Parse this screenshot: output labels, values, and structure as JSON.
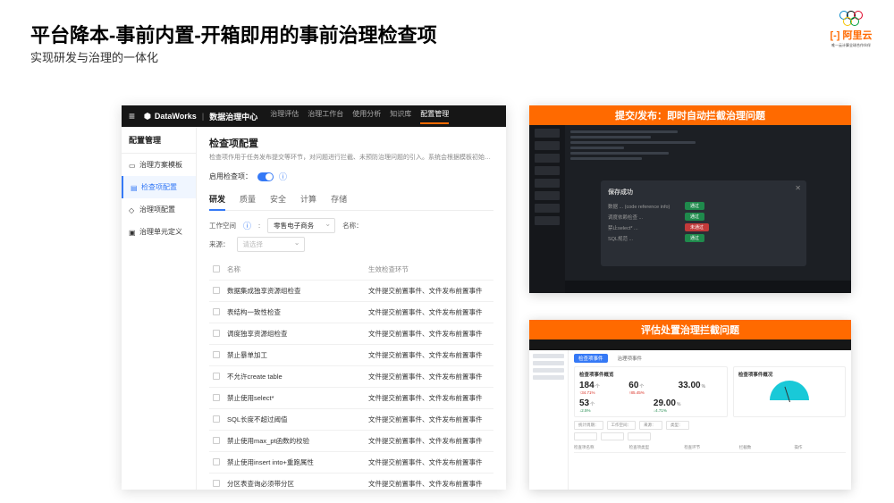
{
  "slide": {
    "title": "平台降本-事前内置-开箱即用的事前治理检查项",
    "subtitle": "实现研发与治理的一体化"
  },
  "logo": {
    "brand": "[-] 阿里云",
    "sub": "唯一云计算全球合作伙伴"
  },
  "main_shot": {
    "brand_product": "DataWorks",
    "brand_module": "数据治理中心",
    "nav_tabs": [
      "治理评估",
      "治理工作台",
      "使用分析",
      "知识库",
      "配置管理"
    ],
    "nav_active": 4,
    "sidebar_title": "配置管理",
    "sidebar_items": [
      {
        "icon": "▭",
        "label": "治理方案模板"
      },
      {
        "icon": "▤",
        "label": "检查项配置"
      },
      {
        "icon": "◇",
        "label": "治理项配置"
      },
      {
        "icon": "▣",
        "label": "治理单元定义"
      }
    ],
    "sidebar_selected": 1,
    "page_title": "检查项配置",
    "page_desc": "检查项作用于任务发布提交等环节，对问题进行拦截、未预防治理问题的引入。系统会根据模板初始…",
    "enable_label": "启用检查项：",
    "content_tabs": [
      "研发",
      "质量",
      "安全",
      "计算",
      "存储"
    ],
    "content_tab_active": 0,
    "filter_workspace_label": "工作空间",
    "filter_workspace_value": "零售电子商务",
    "filter_name_label": "名称：",
    "filter_source_label": "来源：",
    "filter_source_placeholder": "请选择",
    "table_headers": {
      "name": "名称",
      "stage": "生效检查环节"
    },
    "rows": [
      {
        "name": "数据集成独享资源组检查",
        "stage": "文件提交前置事件、文件发布前置事件"
      },
      {
        "name": "表结构一致性检查",
        "stage": "文件提交前置事件、文件发布前置事件"
      },
      {
        "name": "调度独享资源组检查",
        "stage": "文件提交前置事件、文件发布前置事件"
      },
      {
        "name": "禁止暴单加工",
        "stage": "文件提交前置事件、文件发布前置事件"
      },
      {
        "name": "不允许create table",
        "stage": "文件提交前置事件、文件发布前置事件"
      },
      {
        "name": "禁止使用select*",
        "stage": "文件提交前置事件、文件发布前置事件"
      },
      {
        "name": "SQL长度不超过阈值",
        "stage": "文件提交前置事件、文件发布前置事件"
      },
      {
        "name": "禁止使用max_pt函数的校验",
        "stage": "文件提交前置事件、文件发布前置事件"
      },
      {
        "name": "禁止使用insert into+重跑属性",
        "stage": "文件提交前置事件、文件发布前置事件"
      },
      {
        "name": "分区表查询必须带分区",
        "stage": "文件提交前置事件、文件发布前置事件"
      }
    ]
  },
  "right1": {
    "banner": "提交/发布：即时自动拦截治理问题",
    "modal_title": "保存成功",
    "rows": [
      {
        "lab": "数据 ... (code reference info)",
        "pill": "通过",
        "cls": "green"
      },
      {
        "lab": "调度依赖检查 ...",
        "pill": "通过",
        "cls": "green"
      },
      {
        "lab": "禁止select* ...",
        "pill": "未通过",
        "cls": "red"
      },
      {
        "lab": "SQL规范 ...",
        "pill": "通过",
        "cls": "green"
      }
    ]
  },
  "right2": {
    "banner": "评估处置治理拦截问题",
    "tabs": [
      "检查项事件",
      "治理项事件"
    ],
    "card1_title": "检查项事件概览",
    "card2_title": "检查项事件概况",
    "stats_row1": [
      {
        "num": "184",
        "unit": "个",
        "delta": "↑34.71%",
        "dir": "up"
      },
      {
        "num": "60",
        "unit": "个",
        "delta": "↑85.45%",
        "dir": "up"
      },
      {
        "num": "33.00",
        "unit": "%",
        "delta": "",
        "dir": ""
      }
    ],
    "stats_row2": [
      {
        "num": "53",
        "unit": "个",
        "delta": "↓2.5%",
        "dir": "down"
      },
      {
        "num": "29.00",
        "unit": "%",
        "delta": "↓4.71%",
        "dir": "down"
      }
    ],
    "filter_labels": [
      "统计周期：",
      "工作空间：",
      "来源：",
      "类型："
    ],
    "tbl_headers": [
      "检查项名称",
      "检查项类型",
      "检查环节",
      "拦截数",
      "操作"
    ]
  }
}
